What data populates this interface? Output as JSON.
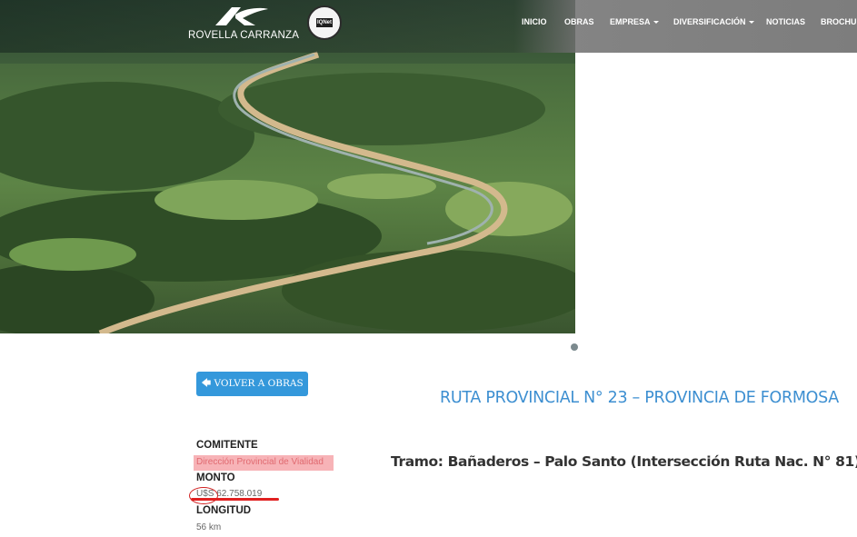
{
  "header": {
    "brand": "ROVELLA CARRANZA",
    "badge_text": "IQNet",
    "nav": [
      "INICIO",
      "OBRAS",
      "EMPRESA",
      "DIVERSIFICACIÓN",
      "NOTICIAS",
      "BROCHURE"
    ]
  },
  "hero": {
    "image_description_icon": "aerial-road-photo"
  },
  "back_button": {
    "label": "VOLVER A OBRAS",
    "icon": "arrow-left-icon"
  },
  "project": {
    "title": "RUTA PROVINCIAL N° 23 – PROVINCIA DE FORMOSA",
    "tramo": "Tramo: Bañaderos – Palo Santo (Intersección Ruta Nac. N° 81)"
  },
  "details": {
    "comitente_label": "COMITENTE",
    "comitente_value": "Dirección Provincial de Vialidad",
    "monto_label": "MONTO",
    "monto_value": "U$S 62.758.019",
    "longitud_label": "LONGITUD",
    "longitud_value": "56 km"
  },
  "colors": {
    "accent": "#3498db",
    "title": "#3d8fd1",
    "highlight": "#f7b3b7",
    "annotation": "#e02020"
  }
}
